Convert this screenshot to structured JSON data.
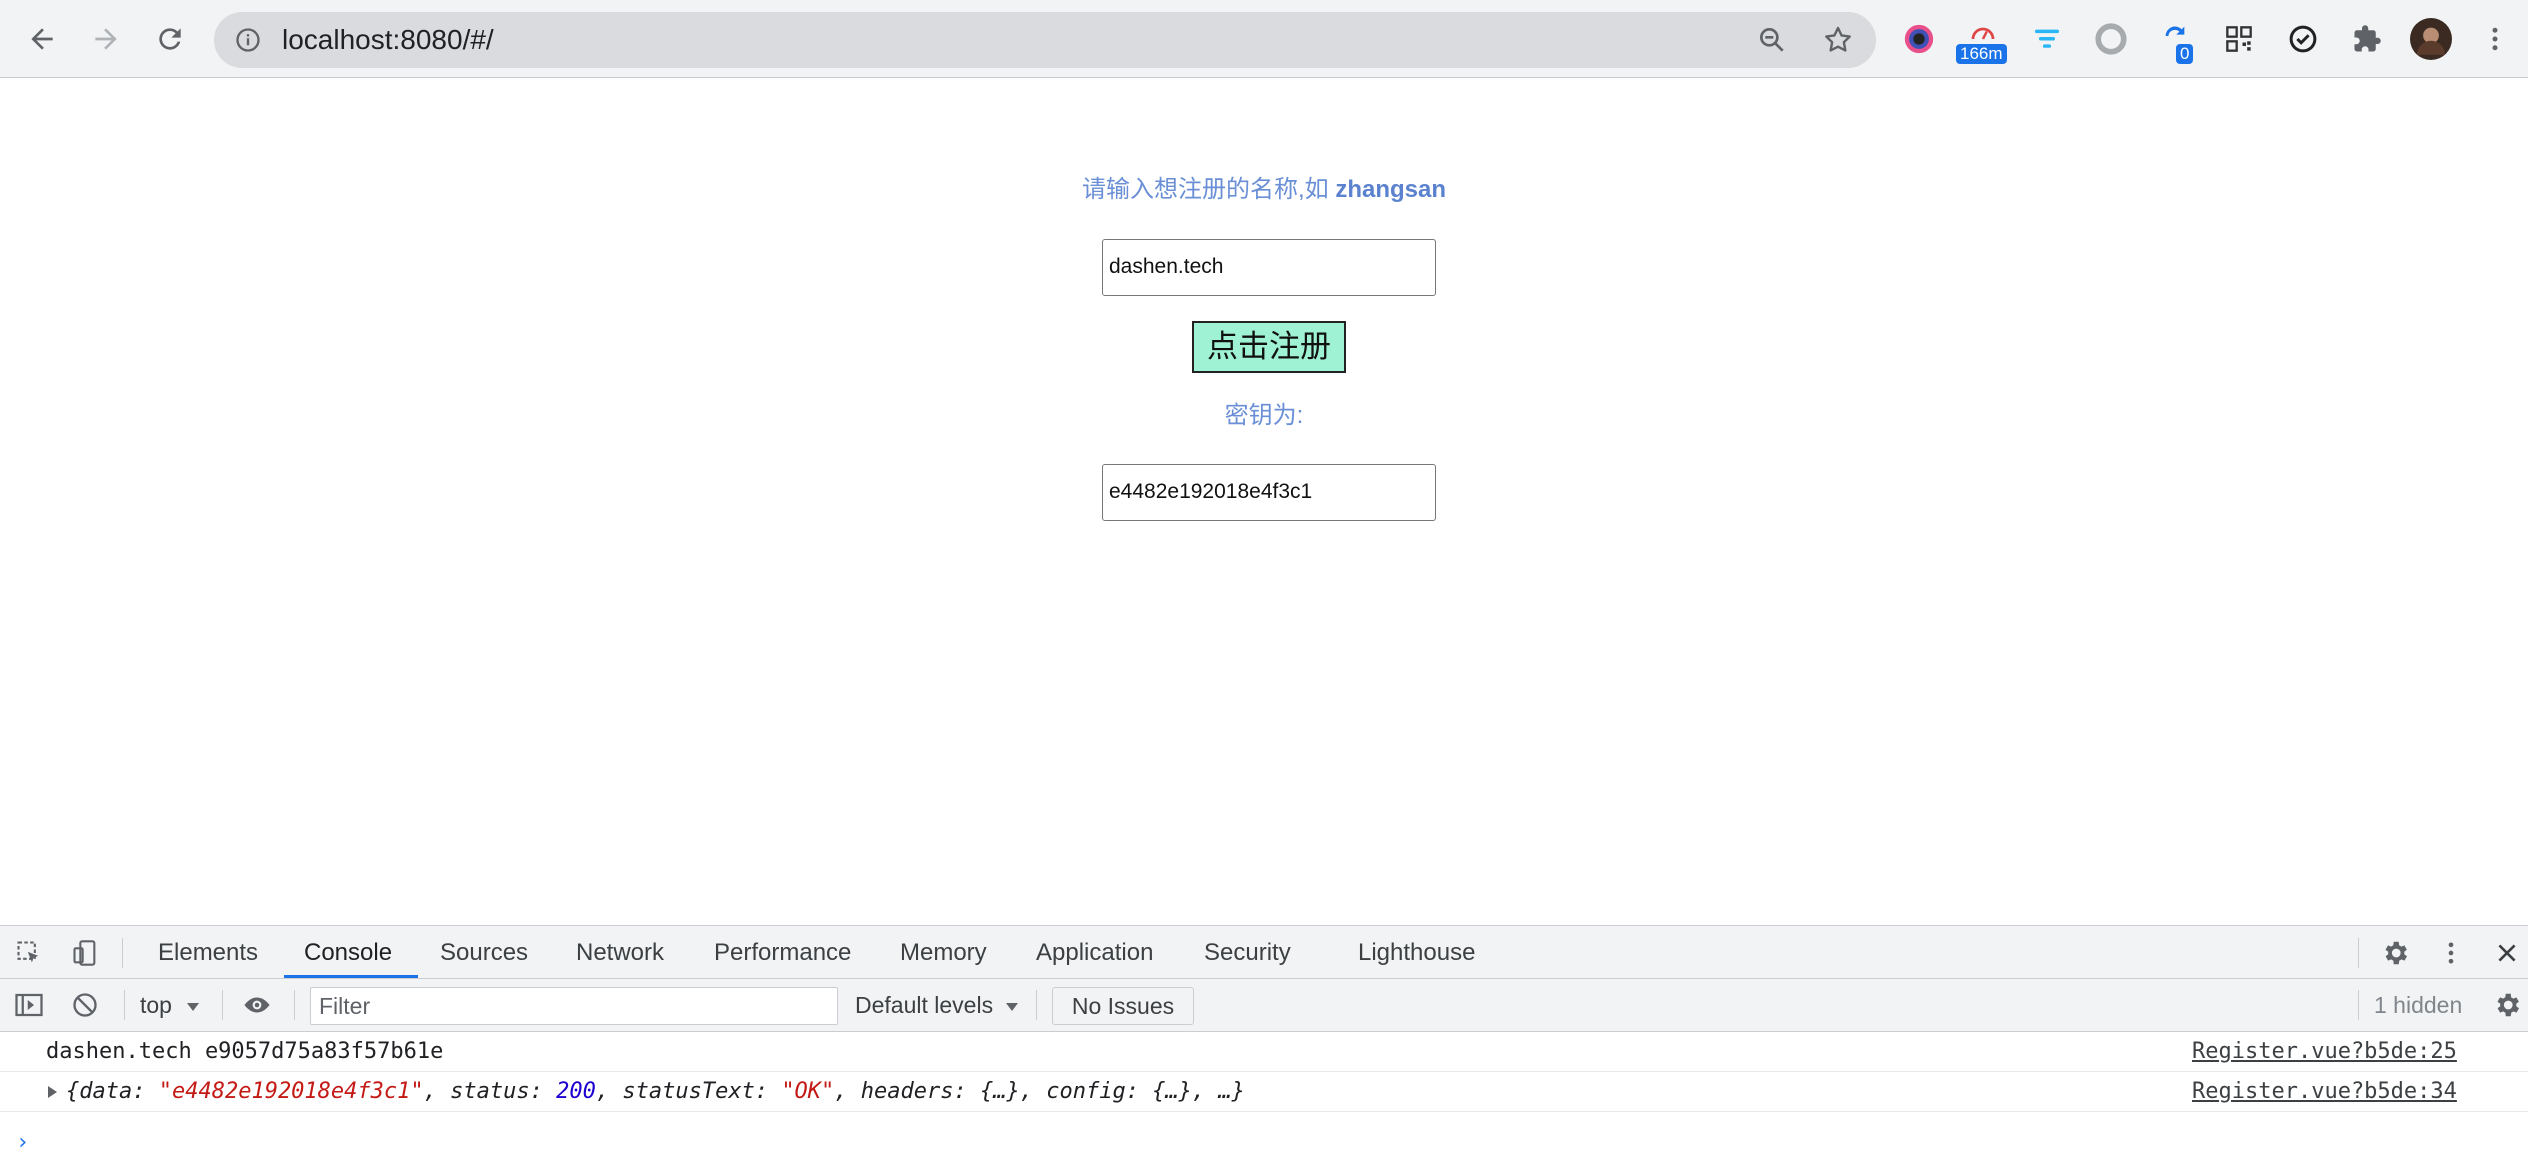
{
  "browser": {
    "url": "localhost:8080/#/",
    "extensions": [
      {
        "icon": "color-picker-icon"
      },
      {
        "icon": "speedometer-icon",
        "badge": "166m"
      },
      {
        "icon": "filter-icon"
      },
      {
        "icon": "circle-icon"
      },
      {
        "icon": "sync-icon",
        "badge": "0"
      },
      {
        "icon": "qr-code-icon"
      },
      {
        "icon": "check-circle-icon"
      },
      {
        "icon": "puzzle-icon"
      }
    ],
    "colors": {
      "toolbar": "#f1f3f4",
      "omnibox": "#d9dbde",
      "badge": "#1a73e8"
    }
  },
  "page": {
    "hint_prefix": "请输入想注册的名称,如 ",
    "hint_example": "zhangsan",
    "name_value": "dashen.tech",
    "register_label": "点击注册",
    "key_label": "密钥为:",
    "key_value": "e4482e192018e4f3c1",
    "colors": {
      "hint": "#6a8fd6",
      "button_bg": "#9ff2d4"
    }
  },
  "devtools": {
    "tabs": [
      "Elements",
      "Console",
      "Sources",
      "Network",
      "Performance",
      "Memory",
      "Application",
      "Security",
      "Lighthouse"
    ],
    "active_tab": "Console",
    "context": "top",
    "filter_placeholder": "Filter",
    "levels": "Default levels",
    "issues": "No Issues",
    "hidden": "1 hidden",
    "logs": [
      {
        "message": "dashen.tech e9057d75a83f57b61e",
        "source": "Register.vue?b5de:25"
      },
      {
        "source": "Register.vue?b5de:34",
        "object": {
          "open": "{",
          "data_key": "data: ",
          "data_val": "\"e4482e192018e4f3c1\"",
          "sep1": ", ",
          "status_key": "status: ",
          "status_val": "200",
          "sep2": ", ",
          "statusText_key": "statusText: ",
          "statusText_val": "\"OK\"",
          "rest": ", headers: {…}, config: {…}, …}"
        }
      }
    ],
    "prompt": "›"
  }
}
